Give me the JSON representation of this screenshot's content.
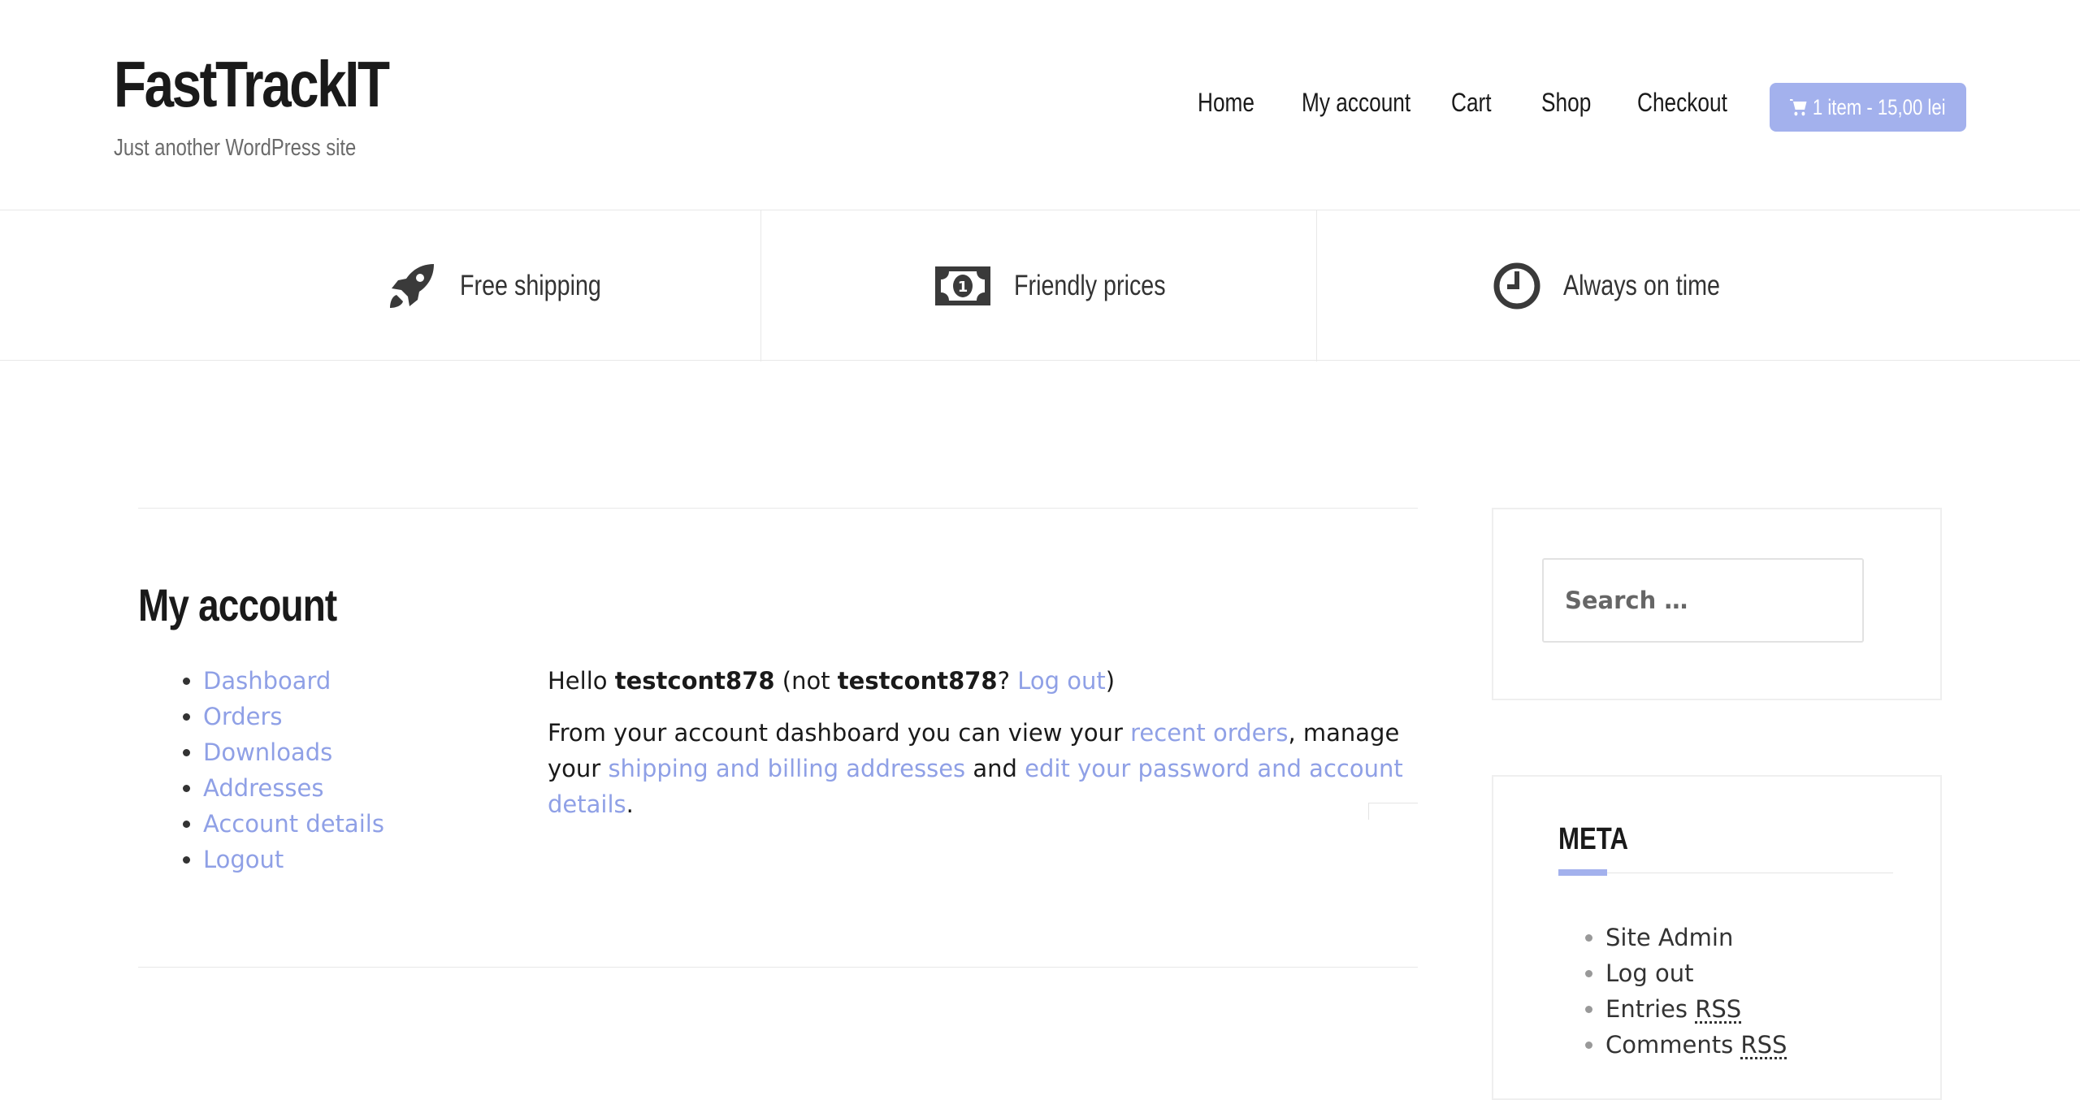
{
  "site": {
    "title": "FastTrackIT",
    "tagline": "Just another WordPress site"
  },
  "nav": {
    "items": [
      {
        "label": "Home"
      },
      {
        "label": "My account"
      },
      {
        "label": "Cart"
      },
      {
        "label": "Shop"
      },
      {
        "label": "Checkout"
      }
    ],
    "cart_label": "1 item - 15,00 lei"
  },
  "features": [
    {
      "label": "Free shipping",
      "icon": "rocket-icon"
    },
    {
      "label": "Friendly prices",
      "icon": "money-bill-icon"
    },
    {
      "label": "Always on time",
      "icon": "clock-icon"
    }
  ],
  "page": {
    "title": "My account"
  },
  "account_nav": {
    "items": [
      {
        "label": "Dashboard"
      },
      {
        "label": "Orders"
      },
      {
        "label": "Downloads"
      },
      {
        "label": "Addresses"
      },
      {
        "label": "Account details"
      },
      {
        "label": "Logout"
      }
    ]
  },
  "dashboard": {
    "hello": "Hello",
    "username": "testcont878",
    "not_prefix": "(not",
    "username_again": "testcont878",
    "question": "?",
    "logout_link": "Log out",
    "close_paren": ")",
    "intro": "From your account dashboard you can view your",
    "recent_orders_link": "recent orders",
    "manage": ", manage your",
    "addresses_link": "shipping and billing addresses",
    "and": "and",
    "edit_link": "edit your password and account details",
    "period": "."
  },
  "sidebar": {
    "search_placeholder": "Search …",
    "meta_title": "META",
    "meta_items": [
      {
        "label": "Site Admin"
      },
      {
        "label": "Log out"
      },
      {
        "label": "Entries",
        "abbr": "RSS"
      },
      {
        "label": "Comments",
        "abbr": "RSS"
      }
    ]
  },
  "colors": {
    "accent": "#a3b1ed",
    "link": "#8fa0e6",
    "text": "#1a1a1a"
  }
}
